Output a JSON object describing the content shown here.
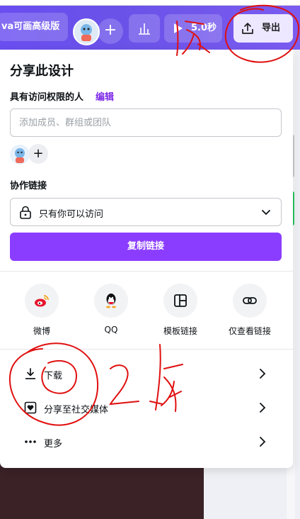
{
  "topbar": {
    "upgrade_label": "va可画高级版",
    "play_label": "5.0秒",
    "export_label": "导出"
  },
  "share": {
    "title": "分享此设计",
    "access_label": "具有访问权限的人",
    "edit_link": "编辑",
    "member_placeholder": "添加成员、群组或团队",
    "collab_label": "协作链接",
    "link_access": "只有你可以访问",
    "copy_button": "复制链接",
    "options": [
      {
        "label": "微博",
        "icon": "weibo-icon"
      },
      {
        "label": "QQ",
        "icon": "qq-icon"
      },
      {
        "label": "模板链接",
        "icon": "template-icon"
      },
      {
        "label": "仅查看链接",
        "icon": "link-icon"
      }
    ],
    "rows": [
      {
        "label": "下载",
        "icon": "download-icon"
      },
      {
        "label": "分享至社交媒体",
        "icon": "heart-icon"
      },
      {
        "label": "更多",
        "icon": "more-icon"
      }
    ]
  },
  "colors": {
    "brand": "#8b3dff",
    "topbar": "#6a4ef0",
    "annotation": "#e01010"
  }
}
